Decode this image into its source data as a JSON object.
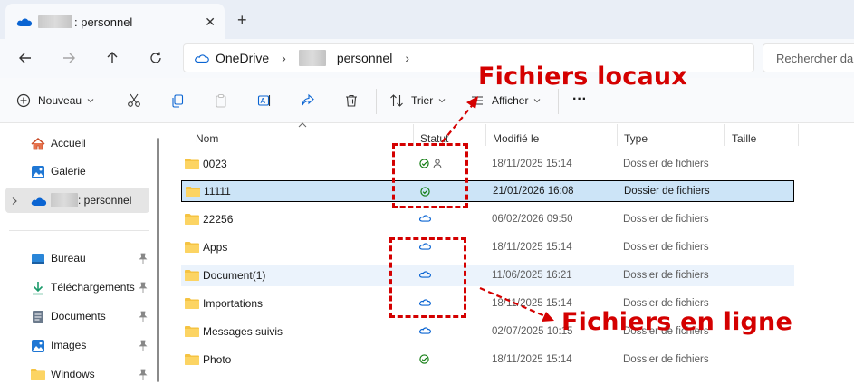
{
  "tab": {
    "title": ": personnel",
    "close_glyph": "✕",
    "new_tab_glyph": "+"
  },
  "address": {
    "root": "OneDrive",
    "folder": "personnel",
    "search_placeholder": "Rechercher dans"
  },
  "toolbar": {
    "new_label": "Nouveau",
    "sort_label": "Trier",
    "view_label": "Afficher",
    "more_glyph": "···"
  },
  "sidebar": {
    "items": [
      {
        "label": "Accueil",
        "icon": "home-icon"
      },
      {
        "label": "Galerie",
        "icon": "gallery-icon"
      },
      {
        "label": ": personnel",
        "icon": "onedrive-cloud-icon"
      },
      {
        "label": "Bureau",
        "icon": "desktop-icon"
      },
      {
        "label": "Téléchargements",
        "icon": "download-icon"
      },
      {
        "label": "Documents",
        "icon": "documents-icon"
      },
      {
        "label": "Images",
        "icon": "images-icon"
      },
      {
        "label": "Windows",
        "icon": "folder-icon"
      }
    ]
  },
  "columns": {
    "name": "Nom",
    "status": "Statut",
    "modified": "Modifié le",
    "type": "Type",
    "size": "Taille"
  },
  "files": [
    {
      "name": "0023",
      "status": "local-shared",
      "modified": "18/11/2025 15:14",
      "type": "Dossier de fichiers"
    },
    {
      "name": "11111",
      "status": "local",
      "modified": "21/01/2026 16:08",
      "type": "Dossier de fichiers"
    },
    {
      "name": "22256",
      "status": "online",
      "modified": "06/02/2026 09:50",
      "type": "Dossier de fichiers"
    },
    {
      "name": "Apps",
      "status": "online",
      "modified": "18/11/2025 15:14",
      "type": "Dossier de fichiers"
    },
    {
      "name": "Document(1)",
      "status": "online",
      "modified": "11/06/2025 16:21",
      "type": "Dossier de fichiers"
    },
    {
      "name": "Importations",
      "status": "online",
      "modified": "18/11/2025 15:14",
      "type": "Dossier de fichiers"
    },
    {
      "name": "Messages suivis",
      "status": "online",
      "modified": "02/07/2025 10:15",
      "type": "Dossier de fichiers"
    },
    {
      "name": "Photo",
      "status": "local",
      "modified": "18/11/2025 15:14",
      "type": "Dossier de fichiers"
    }
  ],
  "annotations": {
    "local": "Fichiers locaux",
    "online": "Fichiers en ligne"
  },
  "colors": {
    "accent": "#0067c0",
    "selection": "#cce4f7",
    "hover": "#ebf3fc",
    "annotation_red": "#d40000",
    "status_green": "#0f7b0f",
    "folder_yellow": "#f5c342"
  }
}
